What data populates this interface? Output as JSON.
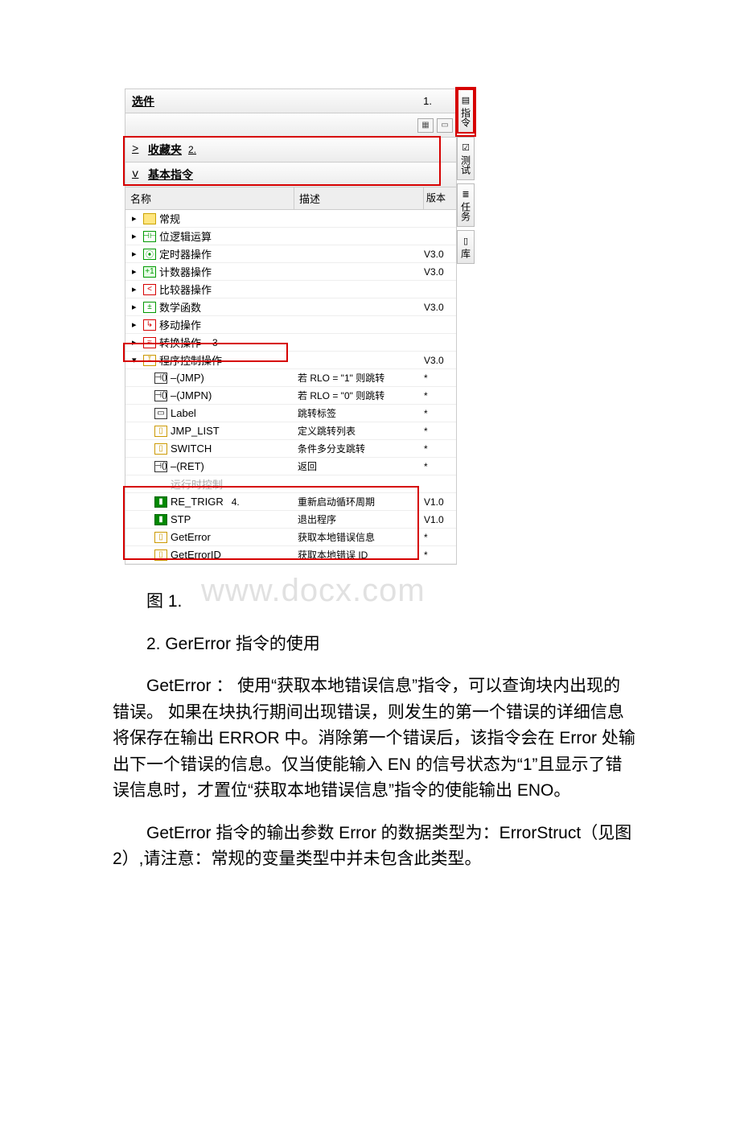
{
  "panel": {
    "title": "选件",
    "marker1": "1.",
    "favorites": {
      "expander": ">",
      "label": "收藏夹",
      "marker": "2."
    },
    "basic": {
      "expander": "v",
      "label": "基本指令"
    },
    "columns": {
      "name": "名称",
      "desc": "描述",
      "ver": "版本"
    }
  },
  "categories": [
    {
      "arrow": "▸",
      "iconClass": "folder-yellow",
      "iconText": "",
      "label": "常规",
      "ver": ""
    },
    {
      "arrow": "▸",
      "iconClass": "i-bit",
      "iconText": "⊣⊢",
      "label": "位逻辑运算",
      "ver": ""
    },
    {
      "arrow": "▸",
      "iconClass": "i-tmr",
      "iconText": "⦿",
      "label": "定时器操作",
      "ver": "V3.0"
    },
    {
      "arrow": "▸",
      "iconClass": "i-cnt",
      "iconText": "+1",
      "label": "计数器操作",
      "ver": "V3.0"
    },
    {
      "arrow": "▸",
      "iconClass": "i-cmp",
      "iconText": "<",
      "label": "比较器操作",
      "ver": ""
    },
    {
      "arrow": "▸",
      "iconClass": "i-math",
      "iconText": "±",
      "label": "数学函数",
      "ver": "V3.0"
    },
    {
      "arrow": "▸",
      "iconClass": "i-mov",
      "iconText": "↳",
      "label": "移动操作",
      "ver": ""
    },
    {
      "arrow": "▸",
      "iconClass": "i-conv",
      "iconText": "≈",
      "label": "转换操作",
      "ver": "",
      "marker": "3"
    },
    {
      "arrow": "▾",
      "iconClass": "i-prg",
      "iconText": "↧",
      "label": "程序控制操作",
      "ver": "V3.0"
    }
  ],
  "children": [
    {
      "iconClass": "i-jmp",
      "iconText": "⊣()",
      "label": "–(JMP)",
      "desc": "若 RLO = \"1\" 则跳转",
      "ver": "*"
    },
    {
      "iconClass": "i-jmp",
      "iconText": "⊣()",
      "label": "–(JMPN)",
      "desc": "若 RLO = \"0\" 则跳转",
      "ver": "*"
    },
    {
      "iconClass": "i-lbl",
      "iconText": "▭",
      "label": "Label",
      "desc": "跳转标签",
      "ver": "*"
    },
    {
      "iconClass": "i-blk",
      "iconText": "▯",
      "label": "JMP_LIST",
      "desc": "定义跳转列表",
      "ver": "*"
    },
    {
      "iconClass": "i-blk",
      "iconText": "▯",
      "label": "SWITCH",
      "desc": "条件多分支跳转",
      "ver": "*"
    },
    {
      "iconClass": "i-jmp",
      "iconText": "⊣()",
      "label": "–(RET)",
      "desc": "返回",
      "ver": "*"
    },
    {
      "disabled": true,
      "iconText": "",
      "label": "运行时控制",
      "desc": "",
      "ver": ""
    },
    {
      "iconClass": "i-block-green",
      "iconText": "▮",
      "label": "RE_TRIGR",
      "desc": "重新启动循环周期",
      "ver": "V1.0",
      "marker": "4."
    },
    {
      "iconClass": "i-block-green",
      "iconText": "▮",
      "label": "STP",
      "desc": "退出程序",
      "ver": "V1.0"
    },
    {
      "iconClass": "i-blk",
      "iconText": "▯",
      "label": "GetError",
      "desc": "获取本地错误信息",
      "ver": "*"
    },
    {
      "iconClass": "i-blk",
      "iconText": "▯",
      "label": "GetErrorID",
      "desc": "获取本地错误 ID",
      "ver": "*"
    }
  ],
  "sidebars": [
    {
      "icon": "▤",
      "label": "指令"
    },
    {
      "icon": "☑",
      "label": "测试"
    },
    {
      "icon": "≣",
      "label": "任务"
    },
    {
      "icon": "▯",
      "label": "库"
    }
  ],
  "text": {
    "fig": "图 1.",
    "h2": "2. GerError 指令的使用",
    "p1": "GetError ： 使用“获取本地错误信息”指令，可以查询块内出现的错误。 如果在块执行期间出现错误，则发生的第一个错误的详细信息将保存在输出 ERROR 中。消除第一个错误后，该指令会在 Error 处输出下一个错误的信息。仅当使能输入 EN 的信号状态为“1”且显示了错误信息时，才置位“获取本地错误信息”指令的使能输出 ENO。",
    "p2": "GetError 指令的输出参数 Error 的数据类型为：ErrorStruct（见图 2）,请注意：常规的变量类型中并未包含此类型。"
  },
  "watermark": "www.docx.com"
}
